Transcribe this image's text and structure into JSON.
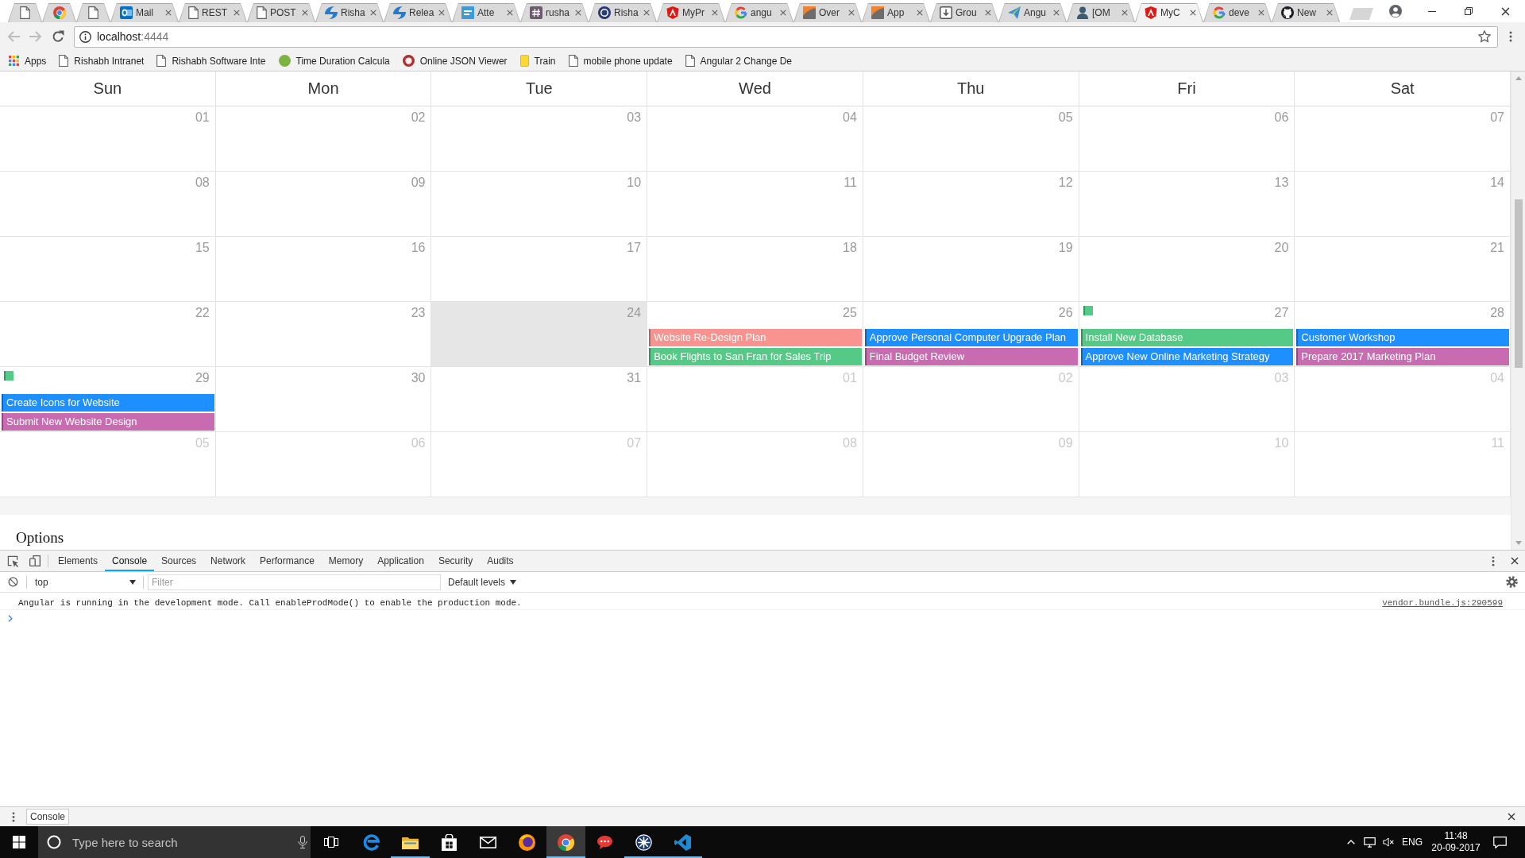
{
  "browser": {
    "tabs": [
      {
        "kind": "page",
        "selected": false
      },
      {
        "kind": "segments",
        "selected": false
      },
      {
        "kind": "page",
        "selected": false
      },
      {
        "kind": "mailtile",
        "title": "Mail",
        "selected": false
      },
      {
        "kind": "page",
        "title": "REST",
        "selected": false
      },
      {
        "kind": "page",
        "title": "POST",
        "selected": false
      },
      {
        "kind": "swirl",
        "title": "Risha",
        "selected": false
      },
      {
        "kind": "swirl",
        "title": "Relea",
        "selected": false
      },
      {
        "kind": "bartile",
        "title": "Atte",
        "selected": false
      },
      {
        "kind": "hashtile",
        "title": "rusha",
        "selected": false
      },
      {
        "kind": "navycircle",
        "title": "Risha",
        "selected": false
      },
      {
        "kind": "shield",
        "title": "MyPr",
        "selected": false
      },
      {
        "kind": "gring",
        "title": "angu",
        "selected": false
      },
      {
        "kind": "slopetile",
        "title": "Over",
        "selected": false
      },
      {
        "kind": "slopetile",
        "title": "App",
        "selected": false
      },
      {
        "kind": "downloadbox",
        "title": "Grou",
        "selected": false
      },
      {
        "kind": "plane",
        "title": "Angu",
        "selected": false
      },
      {
        "kind": "figure",
        "title": "[OM",
        "selected": false
      },
      {
        "kind": "shield",
        "title": "MyC",
        "selected": true
      },
      {
        "kind": "gring",
        "title": "deve",
        "selected": false
      },
      {
        "kind": "catcircle",
        "title": "New",
        "selected": false
      }
    ],
    "navigation": [
      {
        "kind": "back",
        "disabled": true
      },
      {
        "kind": "forward",
        "disabled": true
      },
      {
        "kind": "reload",
        "disabled": false
      }
    ],
    "address": {
      "host": "localhost",
      "port": ":4444"
    },
    "bookmarks": [
      {
        "kind": "grid",
        "label": "Apps"
      },
      {
        "kind": "page",
        "label": "Rishabh Intranet"
      },
      {
        "kind": "page",
        "label": "Rishabh Software Inte"
      },
      {
        "kind": "greendot",
        "label": "Time Duration Calcula"
      },
      {
        "kind": "redring",
        "label": "Online JSON Viewer"
      },
      {
        "kind": "note",
        "label": "Train"
      },
      {
        "kind": "page",
        "label": "mobile phone update"
      },
      {
        "kind": "page",
        "label": "Angular 2 Change De"
      }
    ]
  },
  "calendar": {
    "weekdays": [
      "Sun",
      "Mon",
      "Tue",
      "Wed",
      "Thu",
      "Fri",
      "Sat"
    ],
    "weeks": [
      [
        {
          "day": "01",
          "muted": false,
          "highlighted": false,
          "marker": false
        },
        {
          "day": "02",
          "muted": false,
          "highlighted": false,
          "marker": false
        },
        {
          "day": "03",
          "muted": false,
          "highlighted": false,
          "marker": false
        },
        {
          "day": "04",
          "muted": false,
          "highlighted": false,
          "marker": false
        },
        {
          "day": "05",
          "muted": false,
          "highlighted": false,
          "marker": false
        },
        {
          "day": "06",
          "muted": false,
          "highlighted": false,
          "marker": false
        },
        {
          "day": "07",
          "muted": false,
          "highlighted": false,
          "marker": false
        }
      ],
      [
        {
          "day": "08",
          "muted": false,
          "highlighted": false,
          "marker": false
        },
        {
          "day": "09",
          "muted": false,
          "highlighted": false,
          "marker": false
        },
        {
          "day": "10",
          "muted": false,
          "highlighted": false,
          "marker": false
        },
        {
          "day": "11",
          "muted": false,
          "highlighted": false,
          "marker": false
        },
        {
          "day": "12",
          "muted": false,
          "highlighted": false,
          "marker": false
        },
        {
          "day": "13",
          "muted": false,
          "highlighted": false,
          "marker": false
        },
        {
          "day": "14",
          "muted": false,
          "highlighted": false,
          "marker": false
        }
      ],
      [
        {
          "day": "15",
          "muted": false,
          "highlighted": false,
          "marker": false
        },
        {
          "day": "16",
          "muted": false,
          "highlighted": false,
          "marker": false
        },
        {
          "day": "17",
          "muted": false,
          "highlighted": false,
          "marker": false
        },
        {
          "day": "18",
          "muted": false,
          "highlighted": false,
          "marker": false
        },
        {
          "day": "19",
          "muted": false,
          "highlighted": false,
          "marker": false
        },
        {
          "day": "20",
          "muted": false,
          "highlighted": false,
          "marker": false
        },
        {
          "day": "21",
          "muted": false,
          "highlighted": false,
          "marker": false
        }
      ],
      [
        {
          "day": "22",
          "muted": false,
          "highlighted": false,
          "marker": false
        },
        {
          "day": "23",
          "muted": false,
          "highlighted": false,
          "marker": false
        },
        {
          "day": "24",
          "muted": false,
          "highlighted": true,
          "marker": false
        },
        {
          "day": "25",
          "muted": false,
          "highlighted": false,
          "marker": false,
          "events": [
            {
              "title": "Website Re-Design Plan",
              "color": "#f8938f"
            },
            {
              "title": "Book Flights to San Fran for Sales Trip",
              "color": "#55c986"
            }
          ]
        },
        {
          "day": "26",
          "muted": false,
          "highlighted": false,
          "marker": false,
          "events": [
            {
              "title": "Approve Personal Computer Upgrade Plan",
              "color": "#1e8fff"
            },
            {
              "title": "Final Budget Review",
              "color": "#c96bb0"
            }
          ]
        },
        {
          "day": "27",
          "muted": false,
          "highlighted": false,
          "marker": true,
          "events": [
            {
              "title": "Install New Database",
              "color": "#55c986"
            },
            {
              "title": "Approve New Online Marketing Strategy",
              "color": "#1e8fff"
            }
          ]
        },
        {
          "day": "28",
          "muted": false,
          "highlighted": false,
          "marker": false,
          "events": [
            {
              "title": "Customer Workshop",
              "color": "#1e8fff"
            },
            {
              "title": "Prepare 2017 Marketing Plan",
              "color": "#c96bb0"
            }
          ]
        }
      ],
      [
        {
          "day": "29",
          "muted": false,
          "highlighted": false,
          "marker": true,
          "events": [
            {
              "title": "Create Icons for Website",
              "color": "#1e8fff"
            },
            {
              "title": "Submit New Website Design",
              "color": "#c96bb0"
            }
          ]
        },
        {
          "day": "30",
          "muted": false,
          "highlighted": false,
          "marker": false
        },
        {
          "day": "31",
          "muted": false,
          "highlighted": false,
          "marker": false
        },
        {
          "day": "01",
          "muted": true,
          "highlighted": false,
          "marker": false
        },
        {
          "day": "02",
          "muted": true,
          "highlighted": false,
          "marker": false
        },
        {
          "day": "03",
          "muted": true,
          "highlighted": false,
          "marker": false
        },
        {
          "day": "04",
          "muted": true,
          "highlighted": false,
          "marker": false
        }
      ],
      [
        {
          "day": "05",
          "muted": true,
          "highlighted": false,
          "marker": false
        },
        {
          "day": "06",
          "muted": true,
          "highlighted": false,
          "marker": false
        },
        {
          "day": "07",
          "muted": true,
          "highlighted": false,
          "marker": false
        },
        {
          "day": "08",
          "muted": true,
          "highlighted": false,
          "marker": false
        },
        {
          "day": "09",
          "muted": true,
          "highlighted": false,
          "marker": false
        },
        {
          "day": "10",
          "muted": true,
          "highlighted": false,
          "marker": false
        },
        {
          "day": "11",
          "muted": true,
          "highlighted": false,
          "marker": false
        }
      ]
    ]
  },
  "page": {
    "heading": "Options"
  },
  "devtools": {
    "tabs": [
      {
        "label": "Elements",
        "selected": false
      },
      {
        "label": "Console",
        "selected": true
      },
      {
        "label": "Sources",
        "selected": false
      },
      {
        "label": "Network",
        "selected": false
      },
      {
        "label": "Performance",
        "selected": false
      },
      {
        "label": "Memory",
        "selected": false
      },
      {
        "label": "Application",
        "selected": false
      },
      {
        "label": "Security",
        "selected": false
      },
      {
        "label": "Audits",
        "selected": false
      }
    ],
    "context": "top",
    "filter": {
      "placeholder": "Filter"
    },
    "levels": "Default levels",
    "messages": [
      {
        "text": "Angular is running in the development mode. Call enableProdMode() to enable the production mode.",
        "source": "vendor.bundle.js:290599"
      }
    ]
  },
  "drawer": {
    "tabs": [
      {
        "label": "Console",
        "selected": true
      }
    ]
  },
  "taskbar": {
    "search": {
      "placeholder": "Type here to search"
    },
    "apps": [
      {
        "kind": "eswirl",
        "running": false,
        "selected": false
      },
      {
        "kind": "folder",
        "running": true,
        "selected": false
      },
      {
        "kind": "bag",
        "running": false,
        "selected": false
      },
      {
        "kind": "envelope",
        "running": false,
        "selected": false
      },
      {
        "kind": "globe",
        "running": false,
        "selected": false
      },
      {
        "kind": "segments",
        "running": true,
        "selected": true
      },
      {
        "kind": "bubble",
        "running": false,
        "selected": false
      },
      {
        "kind": "wheel",
        "running": true,
        "selected": false
      },
      {
        "kind": "ribbon",
        "running": true,
        "selected": false
      }
    ],
    "language": "ENG",
    "time": "11:48",
    "date": "20-09-2017"
  }
}
